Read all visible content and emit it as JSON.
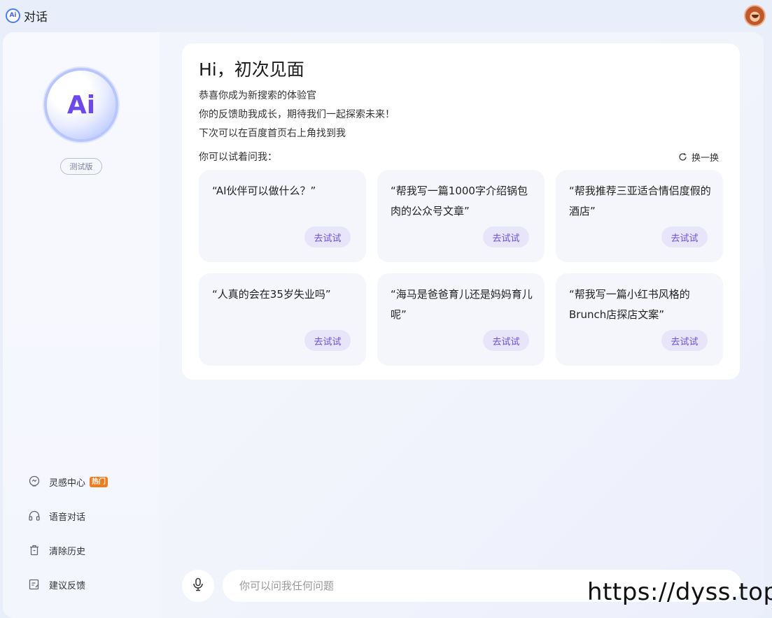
{
  "app": {
    "title": "对话",
    "logo_text": "Ai"
  },
  "sidebar": {
    "logo_text": "Ai",
    "version_badge": "测试版",
    "items": [
      {
        "label": "灵感中心",
        "icon": "lightbulb-icon",
        "badge": "热门"
      },
      {
        "label": "语音对话",
        "icon": "headphones-icon"
      },
      {
        "label": "清除历史",
        "icon": "trash-icon"
      },
      {
        "label": "建议反馈",
        "icon": "feedback-edit-icon"
      }
    ]
  },
  "welcome": {
    "title": "Hi，初次见面",
    "intro": [
      "恭喜你成为新搜索的体验官",
      "你的反馈助我成长，期待我们一起探索未来！",
      "下次可以在百度首页右上角找到我"
    ],
    "try_label": "你可以试着问我：",
    "refresh_label": "换一换",
    "cards": [
      {
        "text": "“AI伙伴可以做什么？”",
        "button": "去试试"
      },
      {
        "text": "“帮我写一篇1000字介绍锅包肉的公众号文章”",
        "button": "去试试"
      },
      {
        "text": "“帮我推荐三亚适合情侣度假的酒店”",
        "button": "去试试"
      },
      {
        "text": "“人真的会在35岁失业吗”",
        "button": "去试试"
      },
      {
        "text": "“海马是爸爸育儿还是妈妈育儿呢”",
        "button": "去试试"
      },
      {
        "text": "“帮我写一篇小红书风格的Brunch店探店文案”",
        "button": "去试试"
      }
    ]
  },
  "input": {
    "placeholder": "你可以问我任何问题",
    "value": ""
  },
  "watermark": "https://dyss.top",
  "colors": {
    "accent": "#6b4fd8",
    "hot_badge": "#f27b1c",
    "card_bg": "#f5f6fb",
    "button_bg": "#e8e5fb"
  }
}
